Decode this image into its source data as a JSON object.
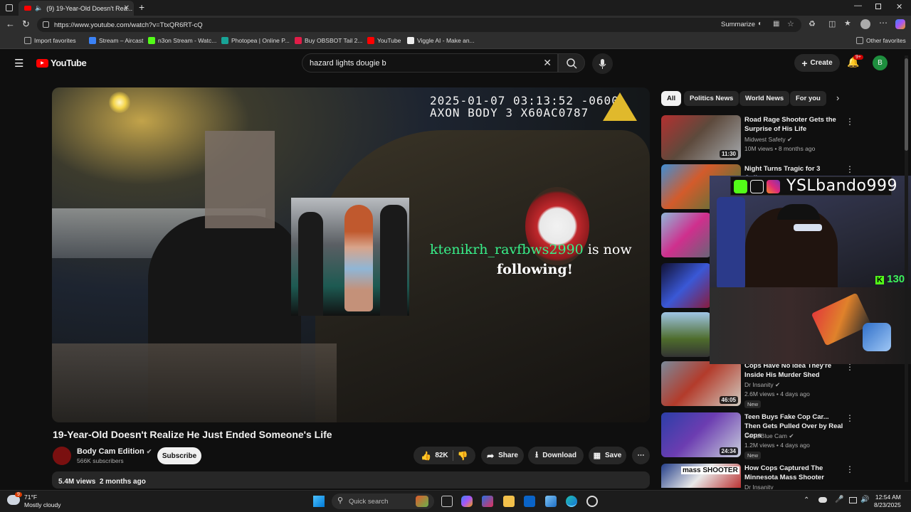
{
  "browser": {
    "tab_title": "(9) 19-Year-Old Doesn't Rea...",
    "url": "https://www.youtube.com/watch?v=TtxQR6RT-cQ",
    "summarize_label": "Summarize",
    "bookmarks": [
      {
        "label": "Import favorites",
        "color": "#888888"
      },
      {
        "label": "Stream – Aircast",
        "color": "#3b82f6"
      },
      {
        "label": "n3on Stream - Watc...",
        "color": "#53fc18"
      },
      {
        "label": "Photopea | Online P...",
        "color": "#18a497"
      },
      {
        "label": "Buy OBSBOT Tail 2...",
        "color": "#e11d48"
      },
      {
        "label": "YouTube",
        "color": "#ff0000"
      },
      {
        "label": "Viggle AI - Make an...",
        "color": "#eeeeee"
      }
    ],
    "other_favorites": "Other favorites"
  },
  "youtube": {
    "logo_text": "YouTube",
    "search_value": "hazard lights dougie b",
    "create_label": "Create",
    "notification_count": "9+",
    "avatar_letter": "B"
  },
  "video": {
    "overlay_timestamp": "2025-01-07 03:13:52 -0600",
    "overlay_device": "AXON BODY 3 X60AC0787",
    "follow_user": "ktenikrh_ravfbws2990",
    "follow_suffix": "is now",
    "follow_line2": "following!",
    "title": "19-Year-Old Doesn't Realize He Just Ended Someone's Life",
    "channel": "Body Cam Edition",
    "subscribers": "566K subscribers",
    "subscribe_label": "Subscribe",
    "likes": "82K",
    "share_label": "Share",
    "download_label": "Download",
    "save_label": "Save",
    "views": "5.4M views",
    "age": "2 months ago"
  },
  "chips": [
    "All",
    "Politics News",
    "World News",
    "For you"
  ],
  "recommendations": [
    {
      "title": "Road Rage Shooter Gets the Surprise of His Life",
      "channel": "Midwest Safety",
      "meta": "10M views • 8 months ago",
      "duration": "11:30",
      "new": ""
    },
    {
      "title": "Night Turns Tragic for 3 College",
      "channel": "",
      "meta": "",
      "duration": "",
      "new": ""
    },
    {
      "title": "Cops Have No Idea They're Inside His Murder Shed",
      "channel": "Dr Insanity",
      "meta": "2.6M views • 4 days ago",
      "duration": "46:05",
      "new": "New"
    },
    {
      "title": "Teen Buys Fake Cop Car... Then Gets Pulled Over by Real Cops",
      "channel": "Code Blue Cam",
      "meta": "1.2M views • 4 days ago",
      "duration": "24:34",
      "new": "New"
    },
    {
      "title": "How Cops Captured The Minnesota Mass Shooter",
      "channel": "Dr Insanity",
      "meta": "",
      "duration": "",
      "new": ""
    }
  ],
  "stream_overlay": {
    "name": "YSLbando999",
    "kick_count": "130"
  },
  "taskbar": {
    "temp": "71°F",
    "weather": "Mostly cloudy",
    "search_placeholder": "Quick search",
    "time": "12:54 AM",
    "date": "8/23/2025",
    "weather_badge": "9"
  }
}
